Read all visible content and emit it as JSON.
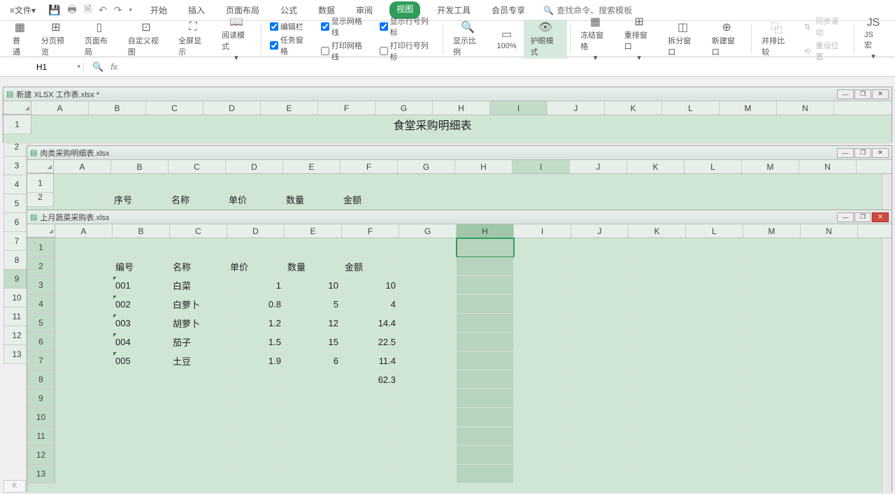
{
  "menu": {
    "file": "文件",
    "tabs": [
      "开始",
      "插入",
      "页面布局",
      "公式",
      "数据",
      "审阅",
      "视图",
      "开发工具",
      "会员专享"
    ],
    "active_tab": "视图",
    "search_placeholder": "查找命令、搜索模板"
  },
  "ribbon": {
    "views": {
      "normal": "普通",
      "page_preview": "分页预览",
      "page_layout": "页面布局",
      "custom_view": "自定义视图",
      "fullscreen": "全屏显示",
      "read_mode": "阅读模式"
    },
    "checks": {
      "edit_bar": "编辑栏",
      "show_grid": "显示网格线",
      "show_headers": "显示行号列标",
      "task_pane": "任务窗格",
      "print_grid": "打印网格线",
      "print_headers": "打印行号列标"
    },
    "zoom": {
      "show_scale": "显示比例",
      "hundred": "100%",
      "eye_protect": "护眼模式"
    },
    "window": {
      "freeze": "冻结窗格",
      "arrange": "重排窗口",
      "split": "拆分窗口",
      "new": "新建窗口"
    },
    "compare": {
      "side": "并排比较",
      "sync": "同步滚动",
      "reset": "重设位置"
    },
    "macro": "JS 宏"
  },
  "formula_bar": {
    "namebox": "H1",
    "fx": "fx"
  },
  "columns": [
    "A",
    "B",
    "C",
    "D",
    "E",
    "F",
    "G",
    "H",
    "I",
    "J",
    "K",
    "L",
    "M",
    "N"
  ],
  "wb1": {
    "title": "新建 XLSX 工作表.xlsx *",
    "merged_title": "食堂采购明细表",
    "selected_col": "I",
    "bg_rows": [
      "2",
      "3",
      "4",
      "5",
      "6",
      "7",
      "8",
      "9",
      "10",
      "11",
      "12",
      "13"
    ],
    "bg_sel_row": "9"
  },
  "wb2": {
    "title": "肉类采购明细表.xlsx",
    "headers": {
      "b": "序号",
      "c": "名称",
      "d": "单价",
      "e": "数量",
      "f": "金额"
    },
    "selected_col": "I"
  },
  "wb3": {
    "title": "上月蔬菜采购表.xlsx",
    "headers": {
      "b": "编号",
      "c": "名称",
      "d": "单价",
      "e": "数量",
      "f": "金额"
    },
    "rows": [
      {
        "id": "001",
        "name": "白菜",
        "price": "1",
        "qty": "10",
        "amt": "10"
      },
      {
        "id": "002",
        "name": "白萝卜",
        "price": "0.8",
        "qty": "5",
        "amt": "4"
      },
      {
        "id": "003",
        "name": "胡萝卜",
        "price": "1.2",
        "qty": "12",
        "amt": "14.4"
      },
      {
        "id": "004",
        "name": "茄子",
        "price": "1.5",
        "qty": "15",
        "amt": "22.5"
      },
      {
        "id": "005",
        "name": "土豆",
        "price": "1.9",
        "qty": "6",
        "amt": "11.4"
      }
    ],
    "total": "62.3",
    "selected_col": "H"
  },
  "chart_data": {
    "type": "table",
    "title": "上月蔬菜采购表",
    "columns": [
      "编号",
      "名称",
      "单价",
      "数量",
      "金额"
    ],
    "rows": [
      [
        "001",
        "白菜",
        1,
        10,
        10
      ],
      [
        "002",
        "白萝卜",
        0.8,
        5,
        4
      ],
      [
        "003",
        "胡萝卜",
        1.2,
        12,
        14.4
      ],
      [
        "004",
        "茄子",
        1.5,
        15,
        22.5
      ],
      [
        "005",
        "土豆",
        1.9,
        6,
        11.4
      ]
    ],
    "total": 62.3
  }
}
